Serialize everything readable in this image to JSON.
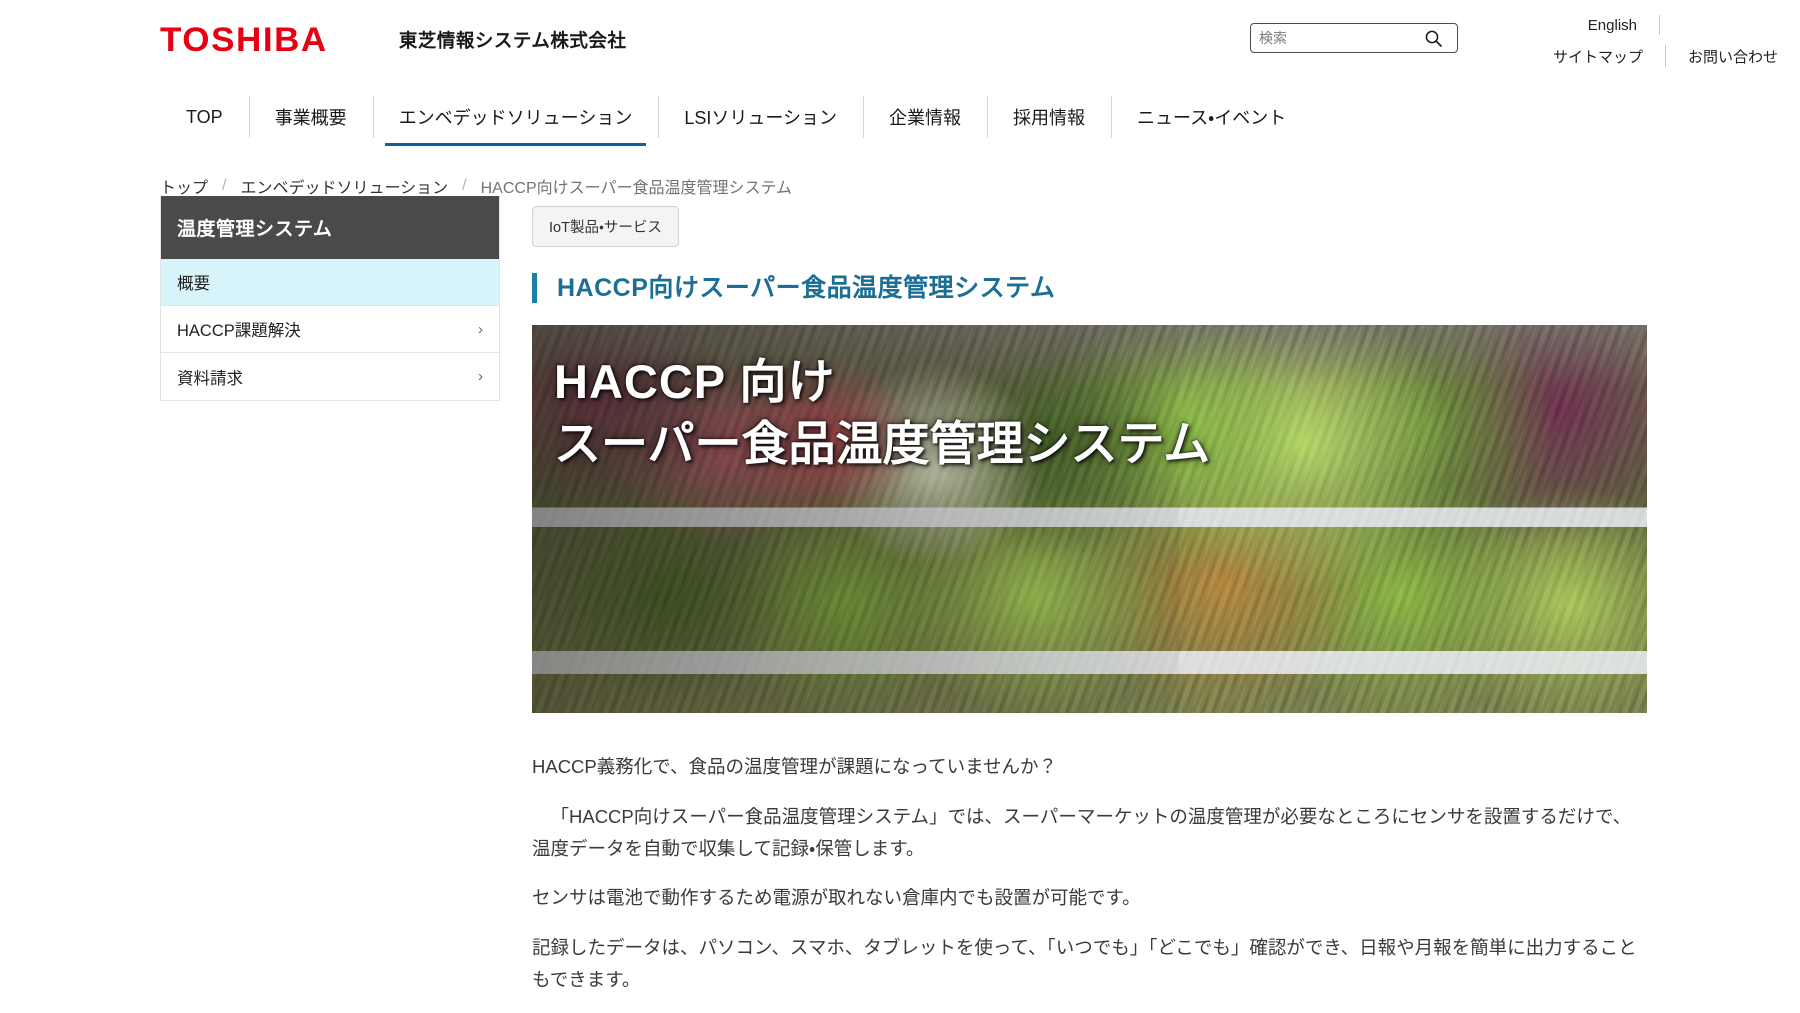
{
  "header": {
    "logo_text": "TOSHIBA",
    "logo_color": "#e60012",
    "company_name": "東芝情報システム株式会社",
    "search": {
      "placeholder": "検索",
      "value": "",
      "icon": "search-icon"
    },
    "util_links": {
      "english": "English",
      "sitemap": "サイトマップ",
      "contact": "お問い合わせ"
    }
  },
  "gnav": {
    "active_index": 2,
    "accent_color": "#0b5fa5",
    "items": [
      {
        "label": "TOP"
      },
      {
        "label": "事業概要"
      },
      {
        "label": "エンベデッドソリューション"
      },
      {
        "label": "LSIソリューション"
      },
      {
        "label": "企業情報"
      },
      {
        "label": "採用情報"
      },
      {
        "label": "ニュース・イベント"
      }
    ]
  },
  "breadcrumb": {
    "separator": "/",
    "items": [
      {
        "label": "トップ",
        "current": false
      },
      {
        "label": "エンベデッドソリューション",
        "current": false
      },
      {
        "label": "HACCP向けスーパー食品温度管理システム",
        "current": true
      }
    ]
  },
  "sidebar": {
    "title": "温度管理システム",
    "title_bg": "#4a4a4a",
    "active_bg": "#d8f4fb",
    "items": [
      {
        "label": "概要",
        "active": true,
        "chevron": ""
      },
      {
        "label": "HACCP課題解決",
        "active": false,
        "chevron": "›"
      },
      {
        "label": "資料請求",
        "active": false,
        "chevron": "›"
      }
    ]
  },
  "main": {
    "tag": "IoT製品・サービス",
    "title": "HACCP向けスーパー食品温度管理システム",
    "title_color": "#1b6f96",
    "hero": {
      "line1": "HACCP 向け",
      "line2": "スーパー食品温度管理システム",
      "alt": "スーパーマーケットの野菜売り場の写真"
    },
    "paragraphs": [
      "HACCP義務化で、食品の温度管理が課題になっていませんか？",
      "「HACCP向けスーパー食品温度管理システム」では、スーパーマーケットの温度管理が必要なところにセンサを設置するだけで、温度データを自動で収集して記録・保管します。",
      "センサは電池で動作するため電源が取れない倉庫内でも設置が可能です。",
      "記録したデータは、パソコン、スマホ、タブレットを使って、「いつでも」「どこでも」確認ができ、日報や月報を簡単に出力することもできます。"
    ]
  }
}
